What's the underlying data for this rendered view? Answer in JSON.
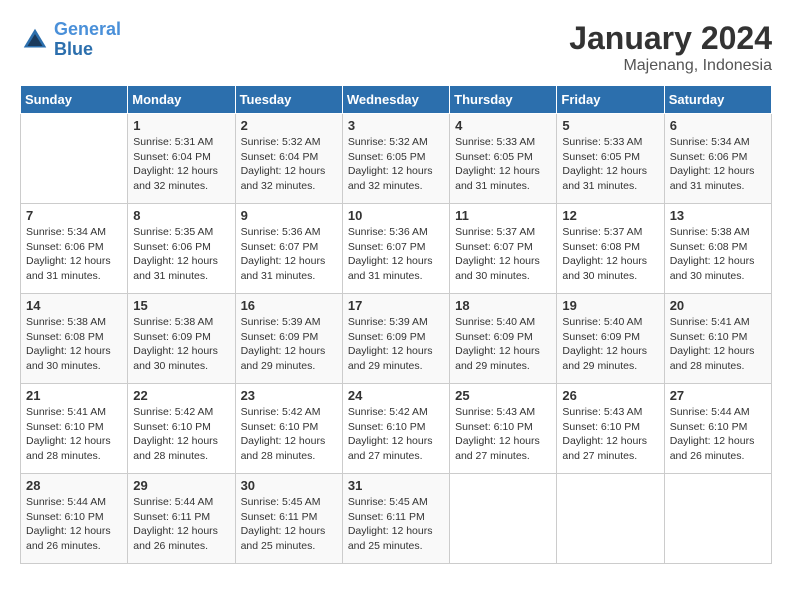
{
  "header": {
    "logo_line1": "General",
    "logo_line2": "Blue",
    "title": "January 2024",
    "subtitle": "Majenang, Indonesia"
  },
  "columns": [
    "Sunday",
    "Monday",
    "Tuesday",
    "Wednesday",
    "Thursday",
    "Friday",
    "Saturday"
  ],
  "weeks": [
    [
      {
        "day": "",
        "info": ""
      },
      {
        "day": "1",
        "info": "Sunrise: 5:31 AM\nSunset: 6:04 PM\nDaylight: 12 hours\nand 32 minutes."
      },
      {
        "day": "2",
        "info": "Sunrise: 5:32 AM\nSunset: 6:04 PM\nDaylight: 12 hours\nand 32 minutes."
      },
      {
        "day": "3",
        "info": "Sunrise: 5:32 AM\nSunset: 6:05 PM\nDaylight: 12 hours\nand 32 minutes."
      },
      {
        "day": "4",
        "info": "Sunrise: 5:33 AM\nSunset: 6:05 PM\nDaylight: 12 hours\nand 31 minutes."
      },
      {
        "day": "5",
        "info": "Sunrise: 5:33 AM\nSunset: 6:05 PM\nDaylight: 12 hours\nand 31 minutes."
      },
      {
        "day": "6",
        "info": "Sunrise: 5:34 AM\nSunset: 6:06 PM\nDaylight: 12 hours\nand 31 minutes."
      }
    ],
    [
      {
        "day": "7",
        "info": "Sunrise: 5:34 AM\nSunset: 6:06 PM\nDaylight: 12 hours\nand 31 minutes."
      },
      {
        "day": "8",
        "info": "Sunrise: 5:35 AM\nSunset: 6:06 PM\nDaylight: 12 hours\nand 31 minutes."
      },
      {
        "day": "9",
        "info": "Sunrise: 5:36 AM\nSunset: 6:07 PM\nDaylight: 12 hours\nand 31 minutes."
      },
      {
        "day": "10",
        "info": "Sunrise: 5:36 AM\nSunset: 6:07 PM\nDaylight: 12 hours\nand 31 minutes."
      },
      {
        "day": "11",
        "info": "Sunrise: 5:37 AM\nSunset: 6:07 PM\nDaylight: 12 hours\nand 30 minutes."
      },
      {
        "day": "12",
        "info": "Sunrise: 5:37 AM\nSunset: 6:08 PM\nDaylight: 12 hours\nand 30 minutes."
      },
      {
        "day": "13",
        "info": "Sunrise: 5:38 AM\nSunset: 6:08 PM\nDaylight: 12 hours\nand 30 minutes."
      }
    ],
    [
      {
        "day": "14",
        "info": "Sunrise: 5:38 AM\nSunset: 6:08 PM\nDaylight: 12 hours\nand 30 minutes."
      },
      {
        "day": "15",
        "info": "Sunrise: 5:38 AM\nSunset: 6:09 PM\nDaylight: 12 hours\nand 30 minutes."
      },
      {
        "day": "16",
        "info": "Sunrise: 5:39 AM\nSunset: 6:09 PM\nDaylight: 12 hours\nand 29 minutes."
      },
      {
        "day": "17",
        "info": "Sunrise: 5:39 AM\nSunset: 6:09 PM\nDaylight: 12 hours\nand 29 minutes."
      },
      {
        "day": "18",
        "info": "Sunrise: 5:40 AM\nSunset: 6:09 PM\nDaylight: 12 hours\nand 29 minutes."
      },
      {
        "day": "19",
        "info": "Sunrise: 5:40 AM\nSunset: 6:09 PM\nDaylight: 12 hours\nand 29 minutes."
      },
      {
        "day": "20",
        "info": "Sunrise: 5:41 AM\nSunset: 6:10 PM\nDaylight: 12 hours\nand 28 minutes."
      }
    ],
    [
      {
        "day": "21",
        "info": "Sunrise: 5:41 AM\nSunset: 6:10 PM\nDaylight: 12 hours\nand 28 minutes."
      },
      {
        "day": "22",
        "info": "Sunrise: 5:42 AM\nSunset: 6:10 PM\nDaylight: 12 hours\nand 28 minutes."
      },
      {
        "day": "23",
        "info": "Sunrise: 5:42 AM\nSunset: 6:10 PM\nDaylight: 12 hours\nand 28 minutes."
      },
      {
        "day": "24",
        "info": "Sunrise: 5:42 AM\nSunset: 6:10 PM\nDaylight: 12 hours\nand 27 minutes."
      },
      {
        "day": "25",
        "info": "Sunrise: 5:43 AM\nSunset: 6:10 PM\nDaylight: 12 hours\nand 27 minutes."
      },
      {
        "day": "26",
        "info": "Sunrise: 5:43 AM\nSunset: 6:10 PM\nDaylight: 12 hours\nand 27 minutes."
      },
      {
        "day": "27",
        "info": "Sunrise: 5:44 AM\nSunset: 6:10 PM\nDaylight: 12 hours\nand 26 minutes."
      }
    ],
    [
      {
        "day": "28",
        "info": "Sunrise: 5:44 AM\nSunset: 6:10 PM\nDaylight: 12 hours\nand 26 minutes."
      },
      {
        "day": "29",
        "info": "Sunrise: 5:44 AM\nSunset: 6:11 PM\nDaylight: 12 hours\nand 26 minutes."
      },
      {
        "day": "30",
        "info": "Sunrise: 5:45 AM\nSunset: 6:11 PM\nDaylight: 12 hours\nand 25 minutes."
      },
      {
        "day": "31",
        "info": "Sunrise: 5:45 AM\nSunset: 6:11 PM\nDaylight: 12 hours\nand 25 minutes."
      },
      {
        "day": "",
        "info": ""
      },
      {
        "day": "",
        "info": ""
      },
      {
        "day": "",
        "info": ""
      }
    ]
  ]
}
